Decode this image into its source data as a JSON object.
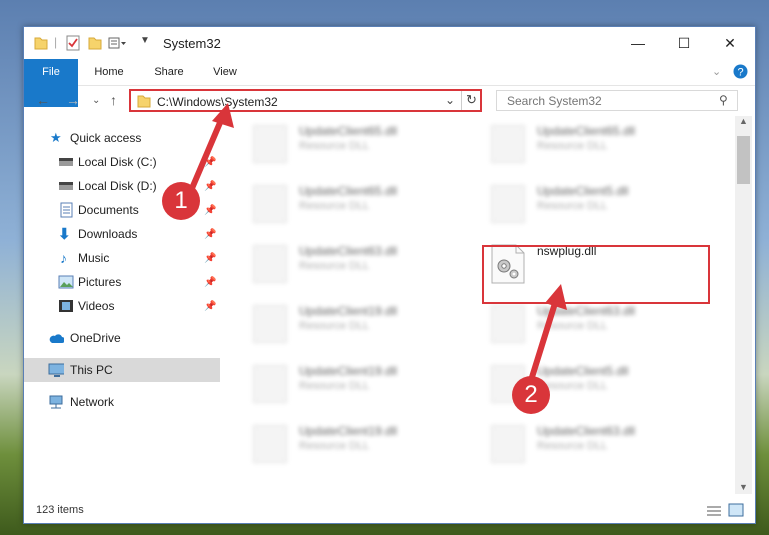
{
  "window": {
    "title": "System32"
  },
  "ribbon": {
    "tabs": [
      "File",
      "Home",
      "Share",
      "View"
    ]
  },
  "address": {
    "path": "C:\\Windows\\System32"
  },
  "search": {
    "placeholder": "Search System32"
  },
  "nav": {
    "quick_access": "Quick access",
    "local_c": "Local Disk (C:)",
    "local_d": "Local Disk (D:)",
    "documents": "Documents",
    "downloads": "Downloads",
    "music": "Music",
    "pictures": "Pictures",
    "videos": "Videos",
    "onedrive": "OneDrive",
    "this_pc": "This PC",
    "network": "Network"
  },
  "files": {
    "col1": [
      "UpdateClient65.dll",
      "UpdateClient65.dll",
      "UpdateClient63.dll",
      "UpdateClient19.dll",
      "UpdateClient19.dll",
      "UpdateClient19.dll"
    ],
    "col2": [
      "UpdateClient65.dll",
      "UpdateClient5.dll",
      "nswplug.dll",
      "UpdateClient63.dll",
      "UpdateClient5.dll",
      "UpdateClient63.dll"
    ],
    "desc": "Resource DLL"
  },
  "status": {
    "item_count": "123 items"
  },
  "annotations": {
    "step1": "1",
    "step2": "2"
  },
  "colors": {
    "accent": "#1979ca",
    "highlight": "#d9353a"
  }
}
